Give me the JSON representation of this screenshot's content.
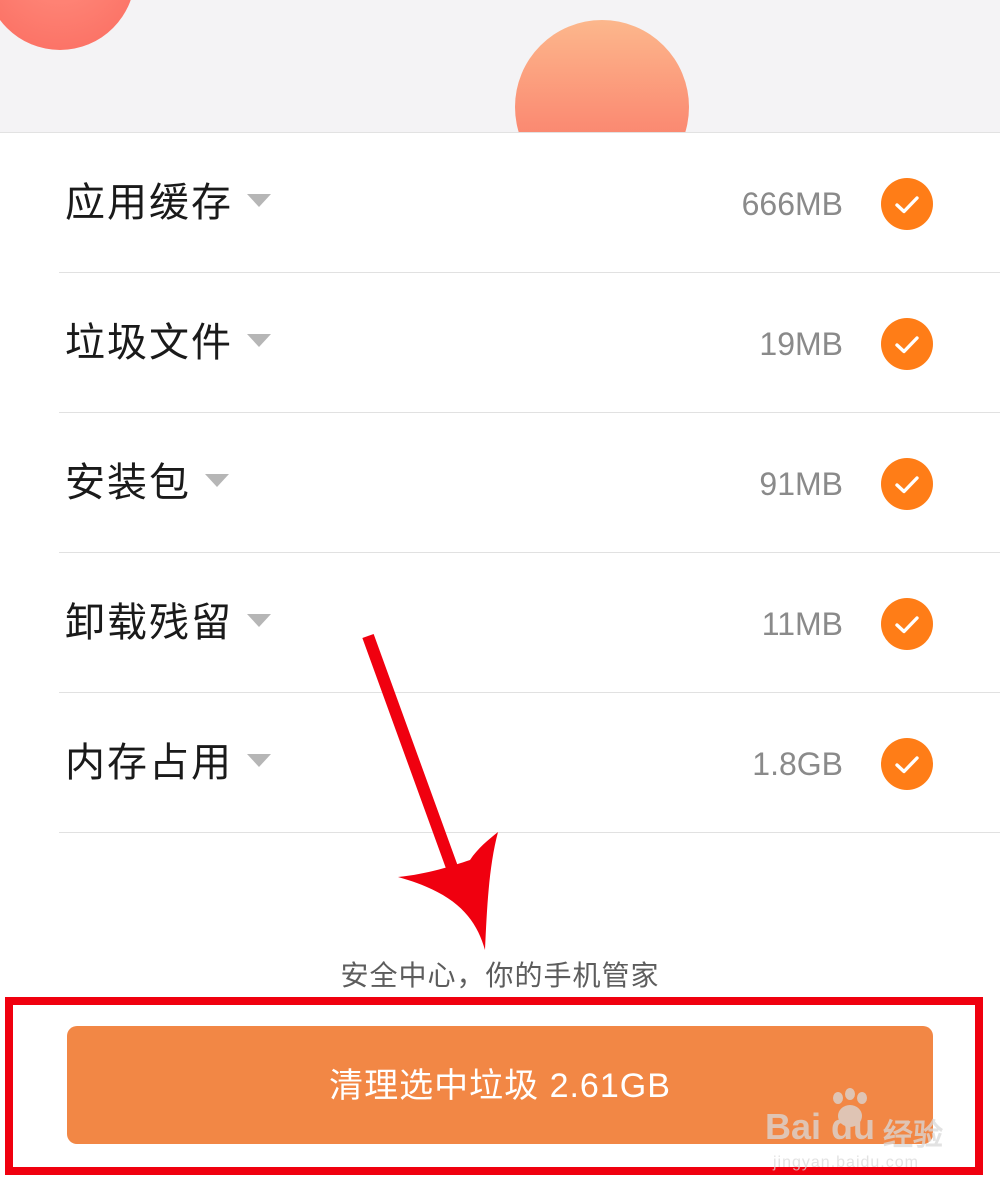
{
  "items": [
    {
      "label": "应用缓存",
      "size": "666MB",
      "checked": true
    },
    {
      "label": "垃圾文件",
      "size": "19MB",
      "checked": true
    },
    {
      "label": "安装包",
      "size": "91MB",
      "checked": true
    },
    {
      "label": "卸载残留",
      "size": "11MB",
      "checked": true
    },
    {
      "label": "内存占用",
      "size": "1.8GB",
      "checked": true
    }
  ],
  "footer": {
    "tagline": "安全中心，你的手机管家",
    "clean_button_label": "清理选中垃圾 2.61GB"
  },
  "watermark": {
    "brand": "Bai du",
    "product": "经验",
    "url": "jingyan.baidu.com"
  },
  "colors": {
    "accent_orange": "#ff7d17",
    "button_orange": "#f28745",
    "annotation_red": "#f0000f"
  },
  "icons": {
    "check": "check-icon",
    "caret": "chevron-down-icon",
    "annotation_arrow": "arrow-down-icon"
  }
}
